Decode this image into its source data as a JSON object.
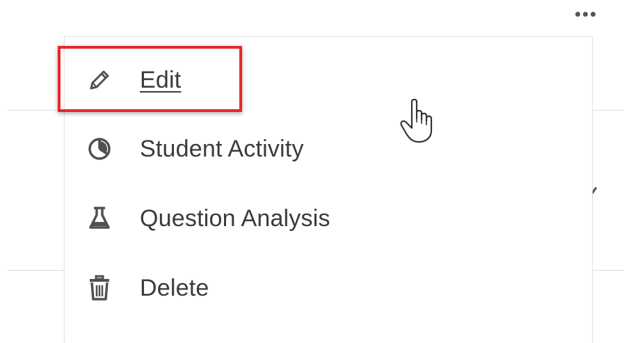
{
  "toolbar": {
    "more_icon": "more-horizontal-icon"
  },
  "menu": {
    "items": [
      {
        "label": "Edit",
        "icon": "pencil-icon"
      },
      {
        "label": "Student Activity",
        "icon": "pie-chart-icon"
      },
      {
        "label": "Question Analysis",
        "icon": "flask-icon"
      },
      {
        "label": "Delete",
        "icon": "trash-icon"
      }
    ]
  },
  "colors": {
    "highlight": "#e8262d",
    "text": "#3b3b3b",
    "icon": "#505050"
  }
}
